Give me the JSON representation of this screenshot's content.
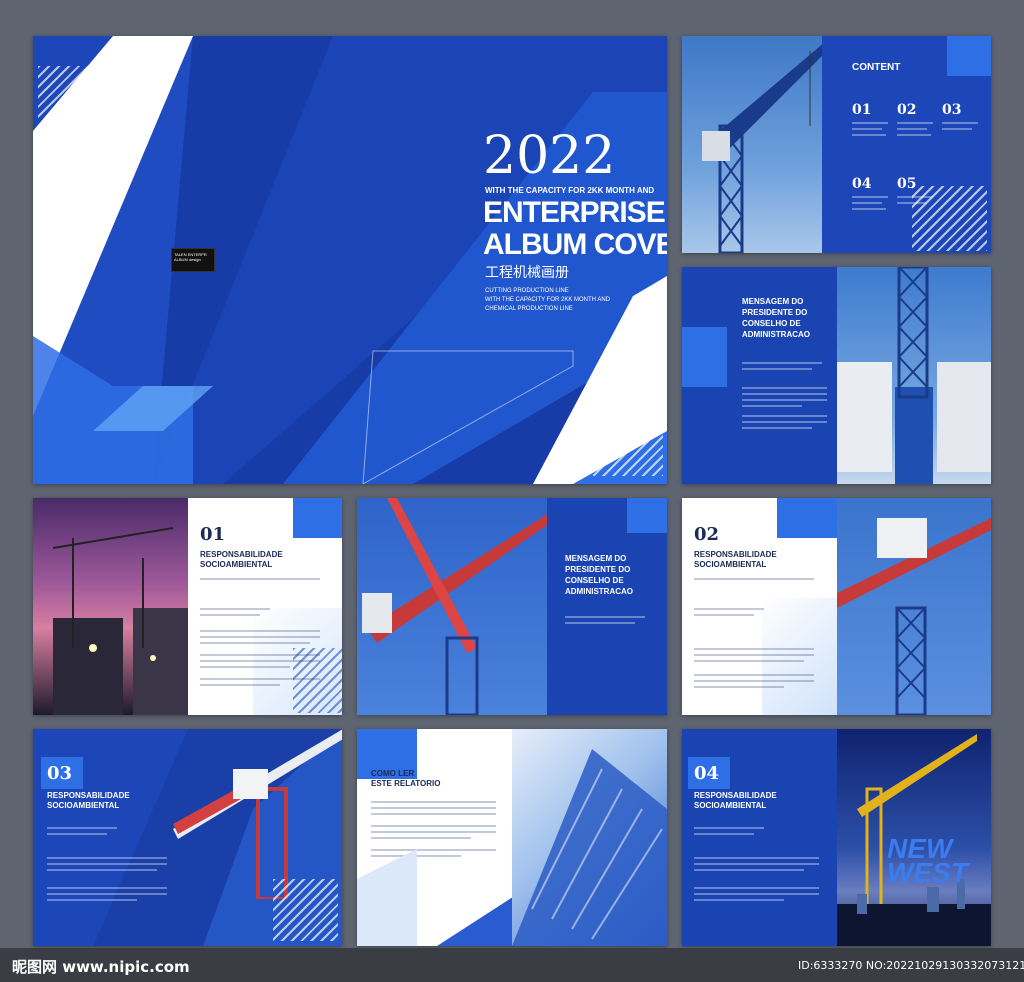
{
  "cover": {
    "year": "2022",
    "capacity": "WITH THE CAPACITY FOR 2KK MONTH AND",
    "title1": "ENTERPRISE",
    "title2": "ALBUM COVER",
    "subtitle_cn": "工程机械画册",
    "desc1": "CUTTING PRODUCTION LINE",
    "desc2": "WITH THE CAPACITY FOR 2KK MONTH AND",
    "desc3": "CHEMICAL PRODUCTION LINE",
    "badge": "TALEN ENTERPR ALBUM design"
  },
  "contents": {
    "heading": "CONTENT",
    "items": [
      "01",
      "02",
      "03",
      "04",
      "05"
    ]
  },
  "message": {
    "title1": "MENSAGEM DO",
    "title2": "PRESIDENTE DO",
    "title3": "CONSELHO DE",
    "title4": "ADMINISTRACAO"
  },
  "section1": {
    "number": "01",
    "title1": "RESPONSABILIDADE",
    "title2": "SOCIOAMBIENTAL"
  },
  "section2": {
    "number": "02",
    "title1": "RESPONSABILIDADE",
    "title2": "SOCIOAMBIENTAL"
  },
  "section3": {
    "number": "03",
    "title1": "RESPONSABILIDADE",
    "title2": "SOCIOAMBIENTAL"
  },
  "section4": {
    "number": "04",
    "title1": "RESPONSABILIDADE",
    "title2": "SOCIOAMBIENTAL"
  },
  "report": {
    "title1": "COMO LER",
    "title2": "ESTE RELATORIO"
  },
  "newwest": {
    "line1": "NEW",
    "line2": "WEST"
  },
  "footer": {
    "logo": "昵图网 www.nipic.com",
    "id": "ID:6333270 NO:20221029130332073121"
  },
  "colors": {
    "brand": "#1d47b8",
    "accent": "#2f6fe6",
    "dark": "#0f2a86"
  }
}
